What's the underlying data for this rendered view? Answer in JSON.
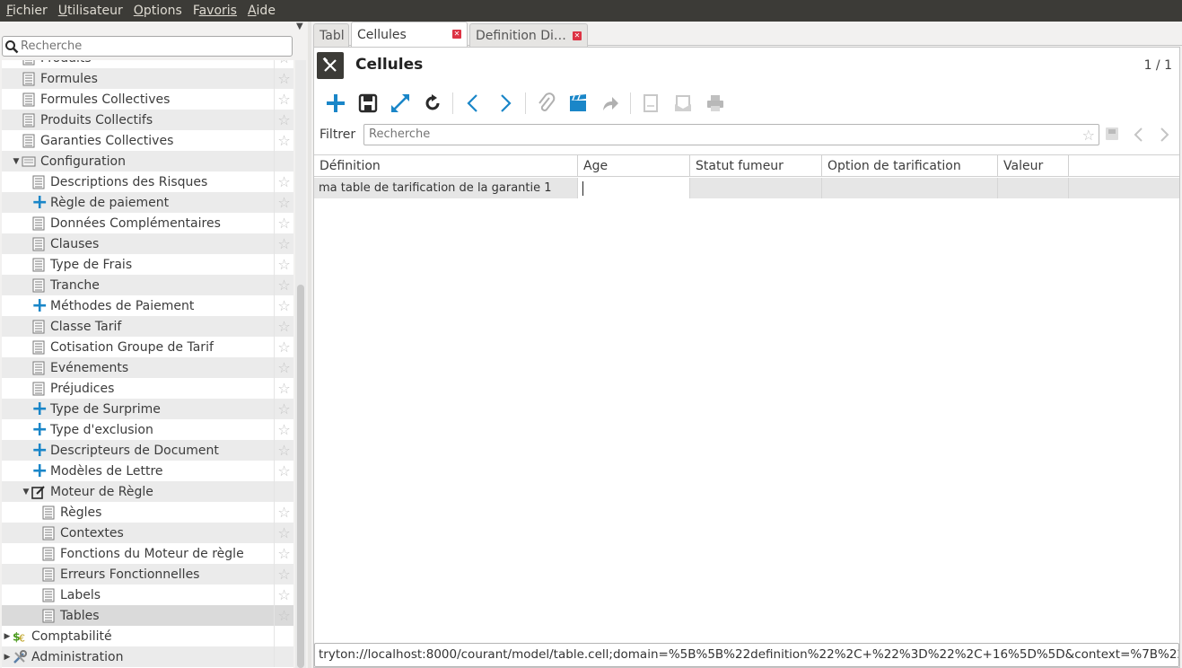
{
  "menubar": {
    "items": [
      {
        "first": "F",
        "rest": "ichier"
      },
      {
        "first": "U",
        "rest": "tilisateur"
      },
      {
        "first": "O",
        "rest": "ptions"
      },
      {
        "first": "F",
        "rest": "avoris"
      },
      {
        "first": "A",
        "rest": "ide"
      }
    ]
  },
  "sidebar": {
    "search_placeholder": "Recherche",
    "items": [
      {
        "label": "Produits"
      },
      {
        "label": "Formules"
      },
      {
        "label": "Formules Collectives"
      },
      {
        "label": "Produits Collectifs"
      },
      {
        "label": "Garanties Collectives"
      },
      {
        "label": "Configuration"
      },
      {
        "label": "Descriptions des Risques"
      },
      {
        "label": "Règle de paiement"
      },
      {
        "label": "Données Complémentaires"
      },
      {
        "label": "Clauses"
      },
      {
        "label": "Type de Frais"
      },
      {
        "label": "Tranche"
      },
      {
        "label": "Méthodes de Paiement"
      },
      {
        "label": "Classe Tarif"
      },
      {
        "label": "Cotisation Groupe de Tarif"
      },
      {
        "label": "Evénements"
      },
      {
        "label": "Préjudices"
      },
      {
        "label": "Type de Surprime"
      },
      {
        "label": "Type d'exclusion"
      },
      {
        "label": "Descripteurs de Document"
      },
      {
        "label": "Modèles de Lettre"
      },
      {
        "label": "Moteur de Règle"
      },
      {
        "label": "Règles"
      },
      {
        "label": "Contextes"
      },
      {
        "label": "Fonctions du Moteur de règle"
      },
      {
        "label": "Erreurs Fonctionnelles"
      },
      {
        "label": "Labels"
      },
      {
        "label": "Tables"
      },
      {
        "label": "Comptabilité"
      },
      {
        "label": "Administration"
      }
    ]
  },
  "tabs": [
    {
      "label": "Tabl"
    },
    {
      "label": "Cellules"
    },
    {
      "label": "Definition Di…"
    }
  ],
  "form": {
    "title": "Cellules",
    "record_count": "1 / 1",
    "filter_label": "Filtrer",
    "filter_placeholder": "Recherche"
  },
  "grid": {
    "columns": [
      "Définition",
      "Age",
      "Statut fumeur",
      "Option de tarification",
      "Valeur"
    ],
    "rows": [
      [
        "ma table de tarification de la garantie 1",
        "",
        "",
        "",
        ""
      ]
    ]
  },
  "url": "tryton://localhost:8000/courant/model/table.cell;domain=%5B%5B%22definition%22%2C+%22%3D%22%2C+16%5D%5D&context=%7B%22ta"
}
